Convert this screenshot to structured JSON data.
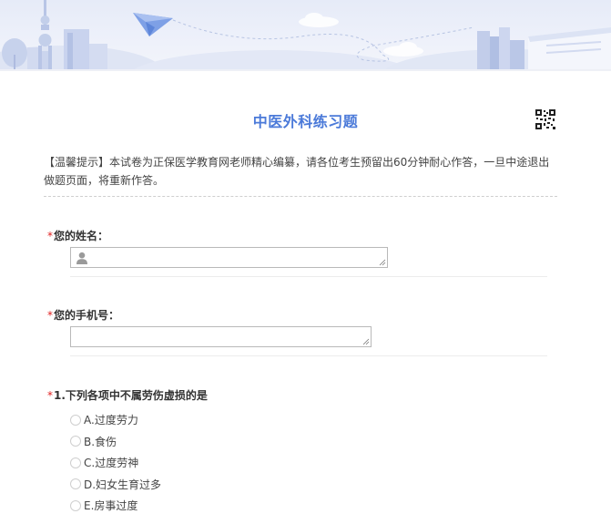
{
  "survey": {
    "title": "中医外科练习题",
    "notice": "【温馨提示】本试卷为正保医学教育网老师精心编纂，请各位考生预留出60分钟耐心作答，一旦中途退出做题页面，将重新作答。"
  },
  "questions": {
    "name": {
      "required_mark": "*",
      "label": "您的姓名：",
      "value": ""
    },
    "phone": {
      "required_mark": "*",
      "label": "您的手机号：",
      "value": ""
    },
    "q1": {
      "required_mark": "*",
      "label": "1.下列各项中不属劳伤虚损的是",
      "options": [
        {
          "label": "A.过度劳力"
        },
        {
          "label": "B.食伤"
        },
        {
          "label": "C.过度劳神"
        },
        {
          "label": "D.妇女生育过多"
        },
        {
          "label": "E.房事过度"
        }
      ]
    }
  },
  "colors": {
    "title": "#4b7ad9",
    "required": "#e02020",
    "banner_bg": "#e6ebf8",
    "banner_shapes": "#c3cfea"
  },
  "icons": {
    "banner": "city-skyline-paper-plane-illustration",
    "qr": "qr-code-icon",
    "name_field": "user-icon"
  }
}
